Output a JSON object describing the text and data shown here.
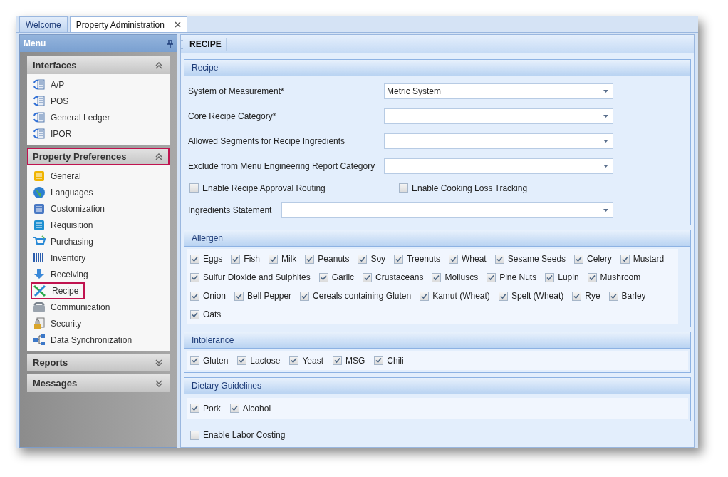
{
  "tabs": [
    {
      "label": "Welcome",
      "selected": false,
      "closable": false
    },
    {
      "label": "Property Administration",
      "selected": true,
      "closable": true
    }
  ],
  "menu": {
    "title": "Menu",
    "groups": [
      {
        "title": "Interfaces",
        "expanded": true,
        "highlighted": false,
        "items": [
          {
            "label": "A/P",
            "highlighted": false
          },
          {
            "label": "POS",
            "highlighted": false
          },
          {
            "label": "General Ledger",
            "highlighted": false
          },
          {
            "label": "IPOR",
            "highlighted": false
          }
        ]
      },
      {
        "title": "Property Preferences",
        "expanded": true,
        "highlighted": true,
        "items": [
          {
            "label": "General",
            "highlighted": false
          },
          {
            "label": "Languages",
            "highlighted": false
          },
          {
            "label": "Customization",
            "highlighted": false
          },
          {
            "label": "Requisition",
            "highlighted": false
          },
          {
            "label": "Purchasing",
            "highlighted": false
          },
          {
            "label": "Inventory",
            "highlighted": false
          },
          {
            "label": "Receiving",
            "highlighted": false
          },
          {
            "label": "Recipe",
            "highlighted": true
          },
          {
            "label": "Communication",
            "highlighted": false
          },
          {
            "label": "Security",
            "highlighted": false
          },
          {
            "label": "Data Synchronization",
            "highlighted": false
          }
        ]
      },
      {
        "title": "Reports",
        "expanded": false,
        "highlighted": false
      },
      {
        "title": "Messages",
        "expanded": false,
        "highlighted": false
      }
    ]
  },
  "toolbar": {
    "title": "RECIPE"
  },
  "recipe": {
    "title": "Recipe",
    "fields": [
      {
        "label": "System of Measurement*",
        "value": "Metric System"
      },
      {
        "label": "Core Recipe Category*"
      },
      {
        "label": "Allowed Segments for Recipe Ingredients"
      },
      {
        "label": "Exclude from Menu Engineering Report Category"
      }
    ],
    "checkboxes": [
      {
        "label": "Enable Recipe Approval Routing",
        "checked": false
      },
      {
        "label": "Enable Cooking Loss Tracking",
        "checked": false
      }
    ],
    "statement": {
      "label": "Ingredients Statement"
    }
  },
  "allergen": {
    "title": "Allergen",
    "items": [
      {
        "label": "Eggs",
        "checked": true
      },
      {
        "label": "Fish",
        "checked": true
      },
      {
        "label": "Milk",
        "checked": true
      },
      {
        "label": "Peanuts",
        "checked": true
      },
      {
        "label": "Soy",
        "checked": true
      },
      {
        "label": "Treenuts",
        "checked": true
      },
      {
        "label": "Wheat",
        "checked": true
      },
      {
        "label": "Sesame Seeds",
        "checked": true
      },
      {
        "label": "Celery",
        "checked": true
      },
      {
        "label": "Mustard",
        "checked": true
      },
      {
        "label": "Sulfur Dioxide and Sulphites",
        "checked": true
      },
      {
        "label": "Garlic",
        "checked": true
      },
      {
        "label": "Crustaceans",
        "checked": true
      },
      {
        "label": "Molluscs",
        "checked": true
      },
      {
        "label": "Pine Nuts",
        "checked": true
      },
      {
        "label": "Lupin",
        "checked": true
      },
      {
        "label": "Mushroom",
        "checked": true
      },
      {
        "label": "Onion",
        "checked": true
      },
      {
        "label": "Bell Pepper",
        "checked": true
      },
      {
        "label": "Cereals containing Gluten",
        "checked": true
      },
      {
        "label": "Kamut (Wheat)",
        "checked": true
      },
      {
        "label": "Spelt (Wheat)",
        "checked": true
      },
      {
        "label": "Rye",
        "checked": true
      },
      {
        "label": "Barley",
        "checked": true
      },
      {
        "label": "Oats",
        "checked": true
      }
    ]
  },
  "intolerance": {
    "title": "Intolerance",
    "items": [
      {
        "label": "Gluten",
        "checked": true
      },
      {
        "label": "Lactose",
        "checked": true
      },
      {
        "label": "Yeast",
        "checked": true
      },
      {
        "label": "MSG",
        "checked": true
      },
      {
        "label": "Chili",
        "checked": true
      }
    ]
  },
  "dietary": {
    "title": "Dietary Guidelines",
    "items": [
      {
        "label": "Pork",
        "checked": true
      },
      {
        "label": "Alcohol",
        "checked": true
      }
    ]
  },
  "labor": {
    "label": "Enable Labor Costing",
    "checked": false
  }
}
